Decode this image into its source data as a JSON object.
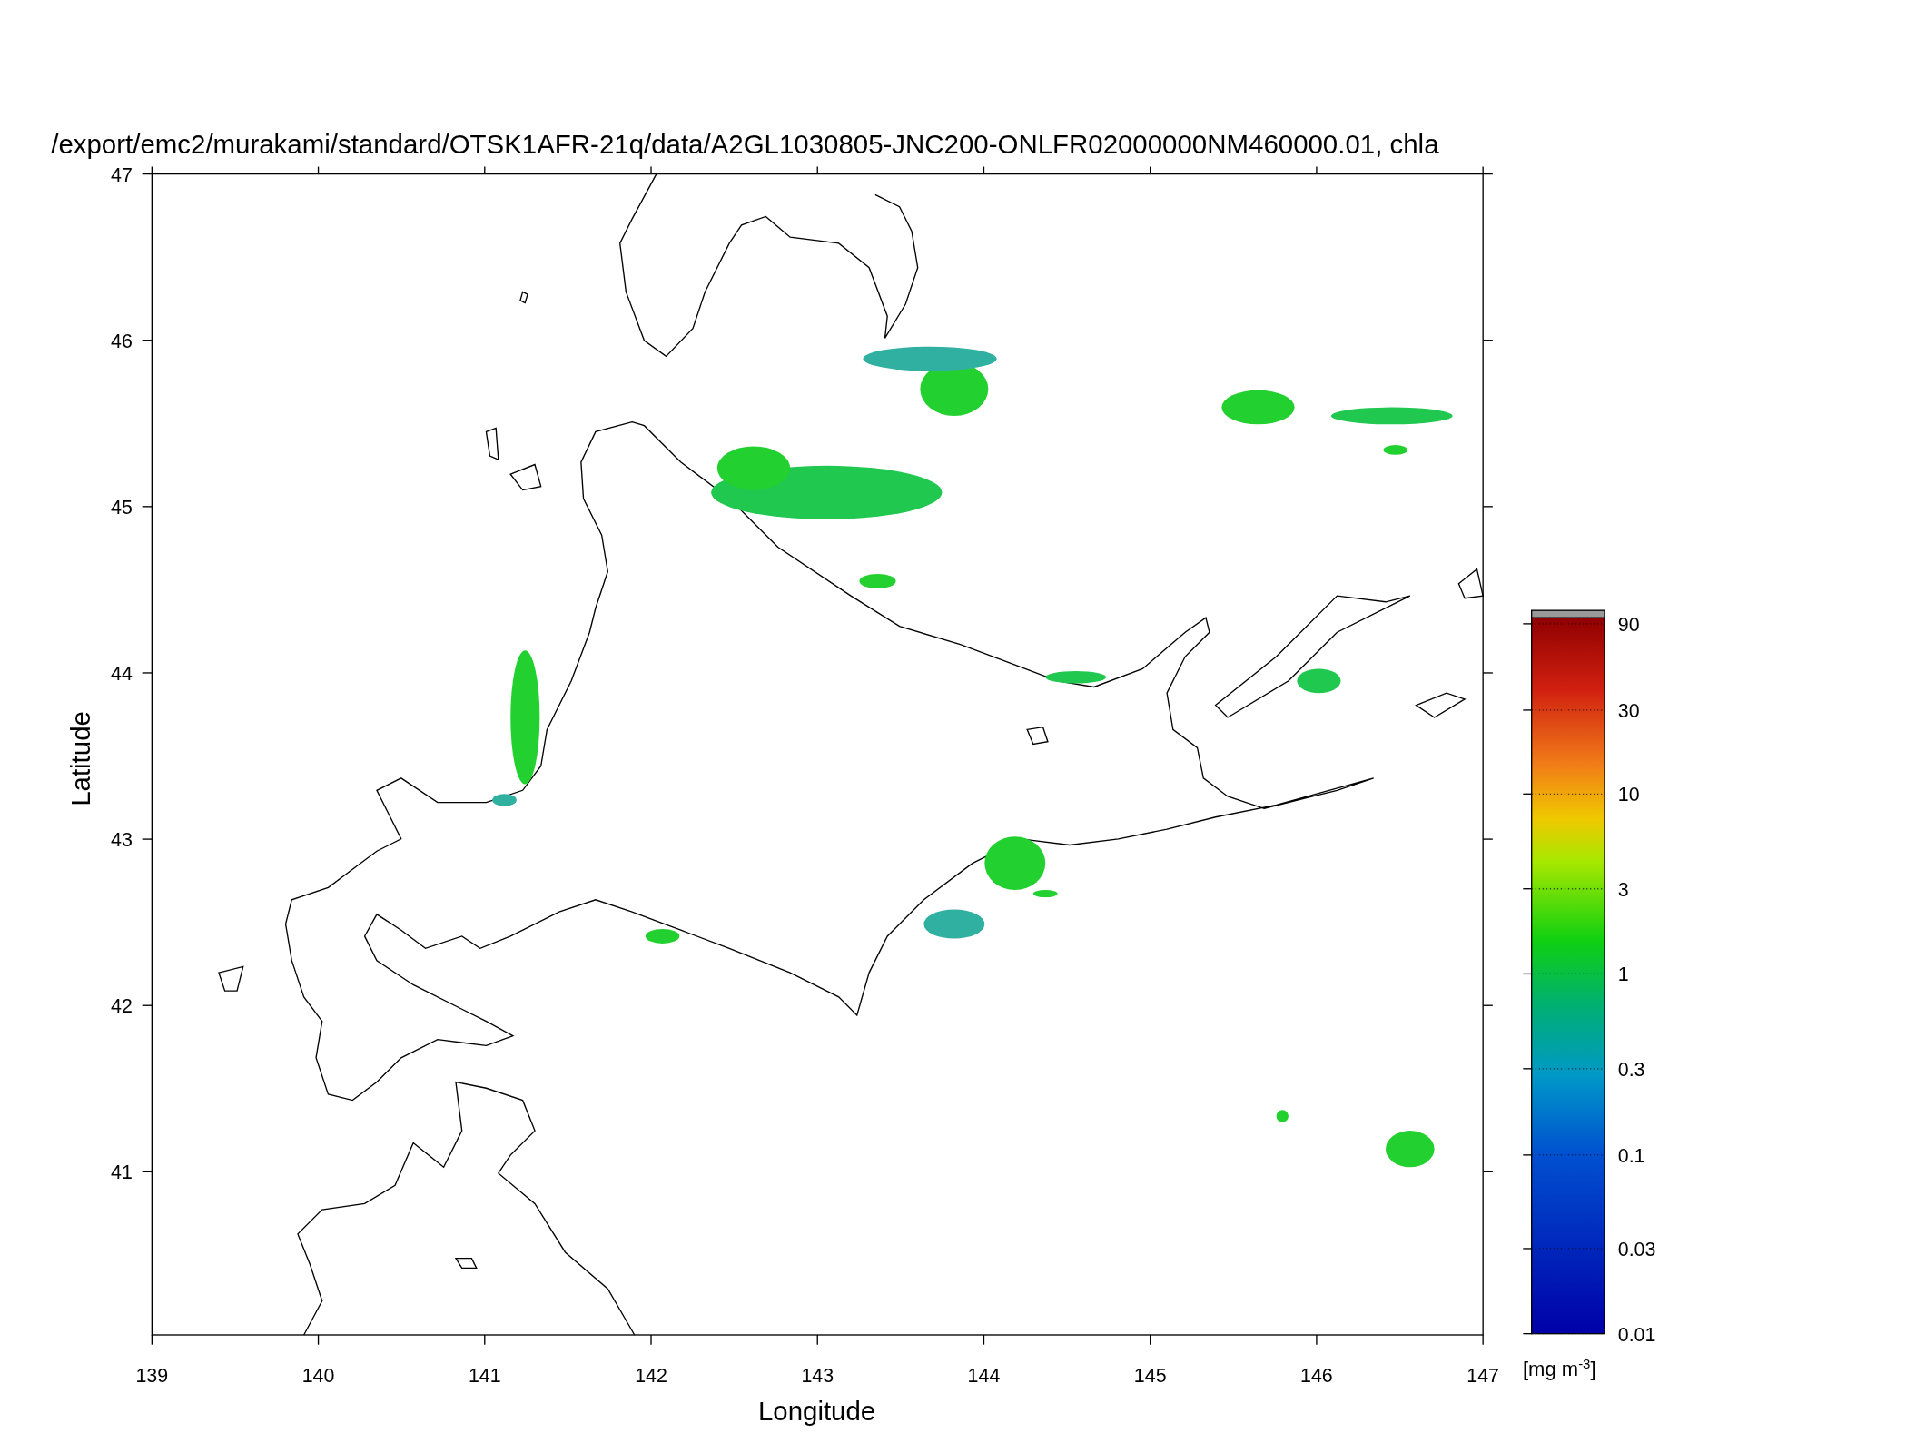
{
  "map": {
    "title": "/export/emc2/murakami/standard/OTSK1AFR-21q/data/A2GL1030805-JNC200-ONLFR02000000NM460000.01, chla",
    "xlabel": "Longitude",
    "ylabel": "Latitude",
    "xticks": [
      "139",
      "140",
      "141",
      "142",
      "143",
      "144",
      "145",
      "146",
      "147"
    ],
    "yticks": [
      "47",
      "46",
      "45",
      "44",
      "43",
      "42",
      "41"
    ]
  },
  "colorbar": {
    "unit": "[mg m$^{-3}$]",
    "ticks": [
      "90",
      "30",
      "10",
      "3",
      "1",
      "0.3",
      "0.1",
      "0.03",
      "0.01"
    ]
  }
}
